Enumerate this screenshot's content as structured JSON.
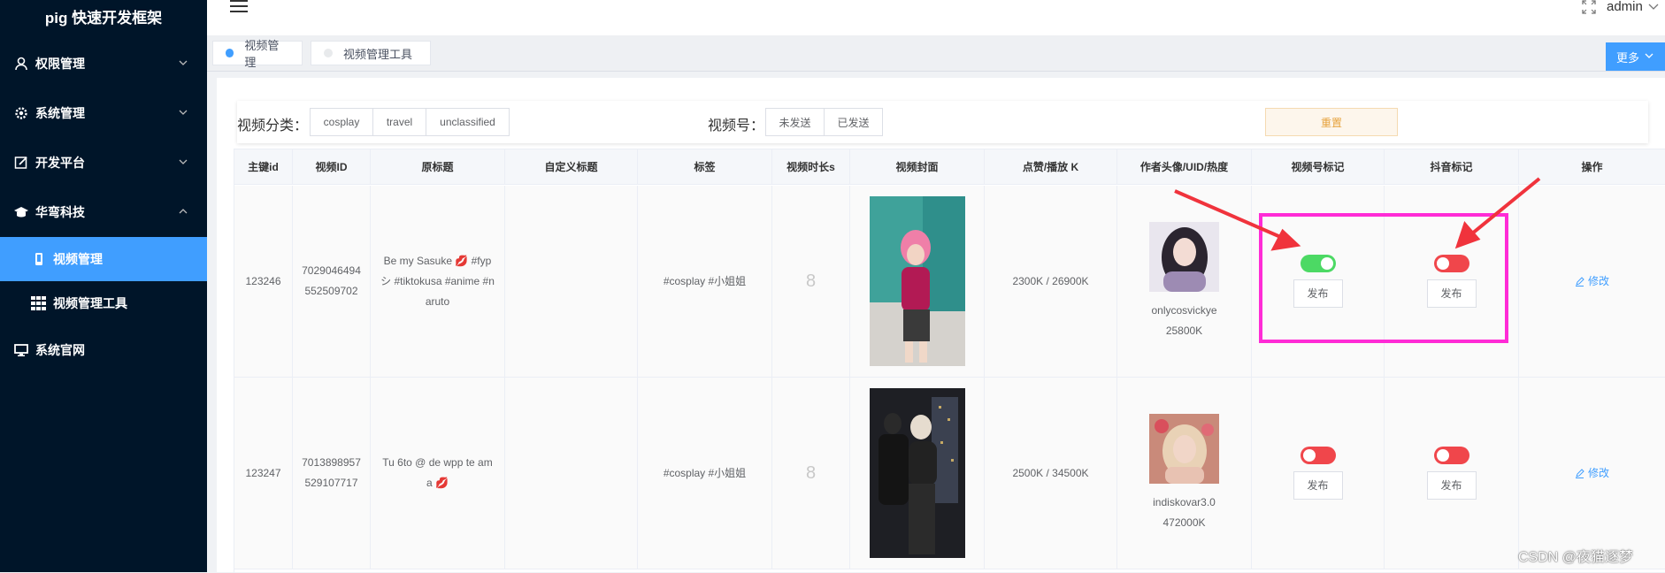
{
  "app": {
    "title": "pig 快速开发框架"
  },
  "sidebar": {
    "items": [
      {
        "label": "权限管理",
        "icon": "user-icon"
      },
      {
        "label": "系统管理",
        "icon": "gear-icon"
      },
      {
        "label": "开发平台",
        "icon": "edit-icon"
      },
      {
        "label": "华弯科技",
        "icon": "graduation-cap-icon"
      },
      {
        "label": "视频管理",
        "icon": "phone-icon"
      },
      {
        "label": "视频管理工具",
        "icon": "grid-icon"
      },
      {
        "label": "系统官网",
        "icon": "monitor-icon"
      }
    ]
  },
  "header": {
    "user": "admin"
  },
  "tabs": [
    {
      "label": "视频管理",
      "dot_color": "#409eff"
    },
    {
      "label": "视频管理工具",
      "dot_color": "#e8eaec"
    }
  ],
  "more_label": "更多",
  "filters": {
    "category_label": "视频分类：",
    "categories": [
      "cosplay",
      "travel",
      "unclassified"
    ],
    "channel_label": "视频号：",
    "channel_options": [
      "未发送",
      "已发送"
    ],
    "reset_label": "重置"
  },
  "table": {
    "headers": [
      "主键id",
      "视频ID",
      "原标题",
      "自定义标题",
      "标签",
      "视频时长s",
      "视频封面",
      "点赞/播放 K",
      "作者头像/UID/热度",
      "视频号标记",
      "抖音标记",
      "操作"
    ],
    "rows": [
      {
        "id": "123246",
        "video_id_1": "7029046494",
        "video_id_2": "552509702",
        "title_1": "Be my Sasuke 💋 #fyp",
        "title_2": "シ #tiktokusa #anime #n",
        "title_3": "aruto",
        "custom_title": "",
        "tags": "#cosplay #小姐姐",
        "duration": "8",
        "stats": "2300K / 26900K",
        "author": "onlycosvickye",
        "heat": "25800K",
        "channel_published": true,
        "douyin_published": false,
        "publish_label": "发布",
        "edit_label": "修改"
      },
      {
        "id": "123247",
        "video_id_1": "7013898957",
        "video_id_2": "529107717",
        "title_1": "Tu 6to @ de wpp te am",
        "title_2": "a 💋",
        "title_3": "",
        "custom_title": "",
        "tags": "#cosplay #小姐姐",
        "duration": "8",
        "stats": "2500K / 34500K",
        "author": "indiskovar3.0",
        "heat": "472000K",
        "channel_published": false,
        "douyin_published": false,
        "publish_label": "发布",
        "edit_label": "修改"
      }
    ]
  },
  "watermark": "CSDN @夜猫逐梦",
  "colors": {
    "sidebar_bg": "#001529",
    "active": "#409eff",
    "switch_on": "#4cd964",
    "switch_off": "#f0464b",
    "highlight": "#ff2bd6",
    "arrow": "#f0333c"
  }
}
